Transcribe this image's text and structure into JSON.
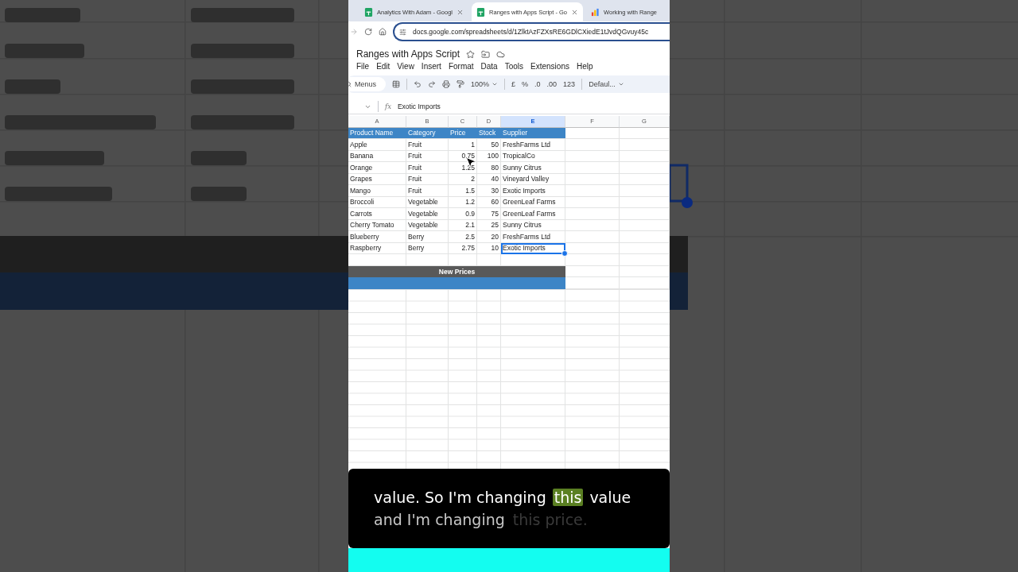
{
  "tabs": [
    {
      "title": "Analytics With Adam - Googl",
      "kind": "spreadsheet",
      "selected": false
    },
    {
      "title": "Ranges with Apps Script - Go",
      "kind": "spreadsheet",
      "selected": true
    },
    {
      "title": "Working with Range",
      "kind": "chart",
      "selected": false
    }
  ],
  "address": "docs.google.com/spreadsheets/d/1ZlktAzFZXsRE6GDlCXiedE1tJvdQGvuy45c",
  "document": {
    "title": "Ranges with Apps Script",
    "menus": [
      "File",
      "Edit",
      "View",
      "Insert",
      "Format",
      "Data",
      "Tools",
      "Extensions",
      "Help"
    ]
  },
  "toolbar": {
    "search": "Menus",
    "zoom": "100%",
    "currency": "£",
    "percent": "%",
    "decrease_decimals": ".0",
    "increase_decimals": ".00",
    "number_format": "123",
    "font": "Defaul..."
  },
  "formula_bar": {
    "label": "fx",
    "value": "Exotic Imports"
  },
  "sheet": {
    "columns": [
      {
        "label": "A",
        "selected": false
      },
      {
        "label": "B",
        "selected": false
      },
      {
        "label": "C",
        "selected": false
      },
      {
        "label": "D",
        "selected": false
      },
      {
        "label": "E",
        "selected": true
      },
      {
        "label": "F",
        "selected": false
      },
      {
        "label": "G",
        "selected": false
      }
    ],
    "header": [
      "Product Name",
      "Category",
      "Price",
      "Stock",
      "Supplier"
    ],
    "rows": [
      {
        "cells": [
          "Apple",
          "Fruit",
          "1",
          "50",
          "FreshFarms Ltd"
        ],
        "selected": false
      },
      {
        "cells": [
          "Banana",
          "Fruit",
          "0.75",
          "100",
          "TropicalCo"
        ],
        "selected": false
      },
      {
        "cells": [
          "Orange",
          "Fruit",
          "1.25",
          "80",
          "Sunny Citrus"
        ],
        "selected": false
      },
      {
        "cells": [
          "Grapes",
          "Fruit",
          "2",
          "40",
          "Vineyard Valley"
        ],
        "selected": false
      },
      {
        "cells": [
          "Mango",
          "Fruit",
          "1.5",
          "30",
          "Exotic Imports"
        ],
        "selected": false
      },
      {
        "cells": [
          "Broccoli",
          "Vegetable",
          "1.2",
          "60",
          "GreenLeaf Farms"
        ],
        "selected": false
      },
      {
        "cells": [
          "Carrots",
          "Vegetable",
          "0.9",
          "75",
          "GreenLeaf Farms"
        ],
        "selected": false
      },
      {
        "cells": [
          "Cherry Tomato",
          "Vegetable",
          "2.1",
          "25",
          "Sunny Citrus"
        ],
        "selected": false
      },
      {
        "cells": [
          "Blueberry",
          "Berry",
          "2.5",
          "20",
          "FreshFarms Ltd"
        ],
        "selected": false
      },
      {
        "cells": [
          "Raspberry",
          "Berry",
          "2.75",
          "10",
          "Exotic Imports"
        ],
        "selected": true
      }
    ],
    "bands": [
      {
        "kind": "title",
        "text": "New Prices"
      },
      {
        "kind": "fill"
      }
    ]
  },
  "caption": {
    "lines": [
      [
        {
          "text": "value. So I'm changing",
          "kind": "said"
        },
        {
          "text": "this",
          "kind": "current"
        },
        {
          "text": "value",
          "kind": "said"
        }
      ],
      [
        {
          "text": "and I'm changing",
          "kind": "next"
        },
        {
          "text": "this price.",
          "kind": "later"
        }
      ]
    ]
  }
}
